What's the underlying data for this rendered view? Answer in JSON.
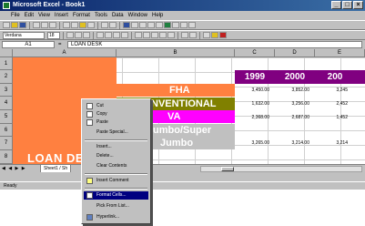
{
  "window": {
    "title": "Microsoft Excel - Book1",
    "minimize": "_",
    "maximize": "□",
    "close": "×"
  },
  "menubar": [
    "File",
    "Edit",
    "View",
    "Insert",
    "Format",
    "Tools",
    "Data",
    "Window",
    "Help"
  ],
  "toolbar": {
    "font_name": "Verdana",
    "font_size": "18"
  },
  "formula_bar": {
    "name_box": "A1",
    "equals": "=",
    "value": "LOAN DESK"
  },
  "columns": [
    "A",
    "B",
    "C",
    "D",
    "E"
  ],
  "rows": [
    "1",
    "2",
    "3",
    "4",
    "5",
    "6",
    "7",
    "8"
  ],
  "sheet": {
    "title": "LOAN DESK",
    "years": [
      "1999",
      "2000",
      "200"
    ],
    "labels": {
      "fha": "FHA",
      "conventional": "NVENTIONAL",
      "va": "VA",
      "jumbo1": "umbo/Super",
      "jumbo2": "Jumbo"
    },
    "values": {
      "r1": [
        "3,450.00",
        "3,852.00",
        "3,245"
      ],
      "r2": [
        "1,632.00",
        "3,256.00",
        "2,452"
      ],
      "r3": [
        "2,368.00",
        "2,687.00",
        "1,452"
      ],
      "r4": [
        "3,265.00",
        "3,214.00",
        "3,214"
      ]
    },
    "colors": {
      "title_fill": "#ff8040",
      "year_fill": "#800080",
      "fha_fill": "#ff8040",
      "conv_fill": "#808000",
      "va_fill": "#ff00ff",
      "jumbo_fill": "#c0c0c0"
    }
  },
  "tabs": {
    "nav": "◀ ◀ ▶ ▶",
    "sheet1": "Sheet1 / Sh"
  },
  "status": "Ready",
  "context_menu": {
    "items": [
      "Cut",
      "Copy",
      "Paste",
      "Paste Special...",
      "Insert...",
      "Delete...",
      "Clear Contents",
      "Insert Comment",
      "Format Cells...",
      "Pick From List...",
      "Hyperlink..."
    ],
    "selected": "Format Cells..."
  }
}
